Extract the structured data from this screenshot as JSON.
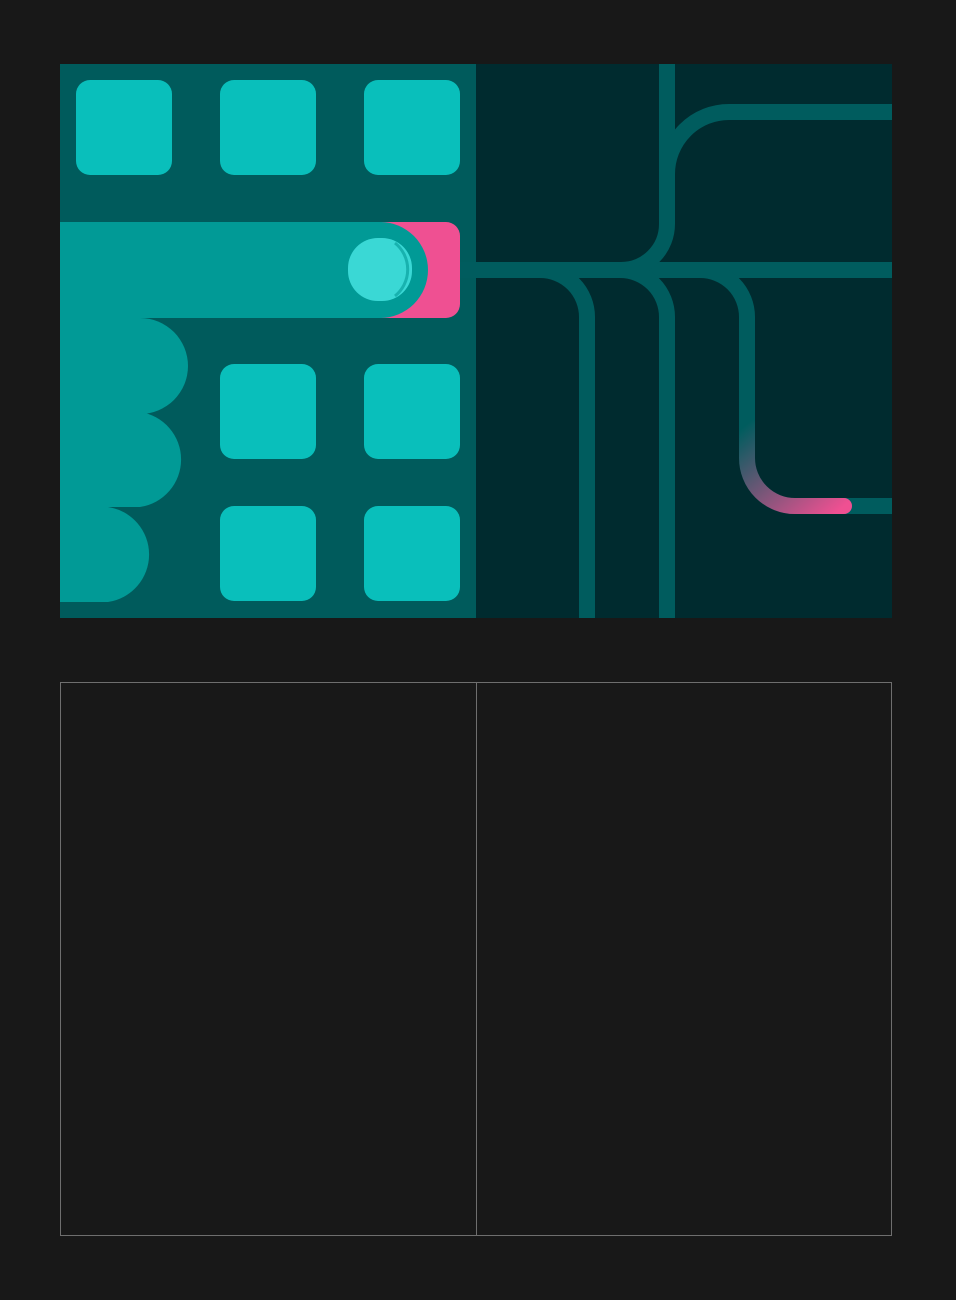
{
  "colors": {
    "page_background": "#181818",
    "left_panel": "#005b5c",
    "right_panel": "#002b2f",
    "tile": "#09bfbb",
    "slot": "#019a96",
    "knob": "#3ad8d5",
    "accent_pink": "#ef5092",
    "track": "#005c5e",
    "glow": "#d8fbf7",
    "placeholder_border": "#6e6e6e"
  },
  "artwork": {
    "tile_grid_icons": [
      "tile-icon",
      "tile-icon",
      "tile-icon",
      "tile-icon",
      "tile-icon",
      "tile-icon",
      "tile-icon"
    ],
    "active_slot": "pink-capped-slot-with-knob",
    "circuit": {
      "pink_glow_segments": 2,
      "white_glow_segments": 4
    }
  },
  "placeholder": {
    "columns": 2
  }
}
